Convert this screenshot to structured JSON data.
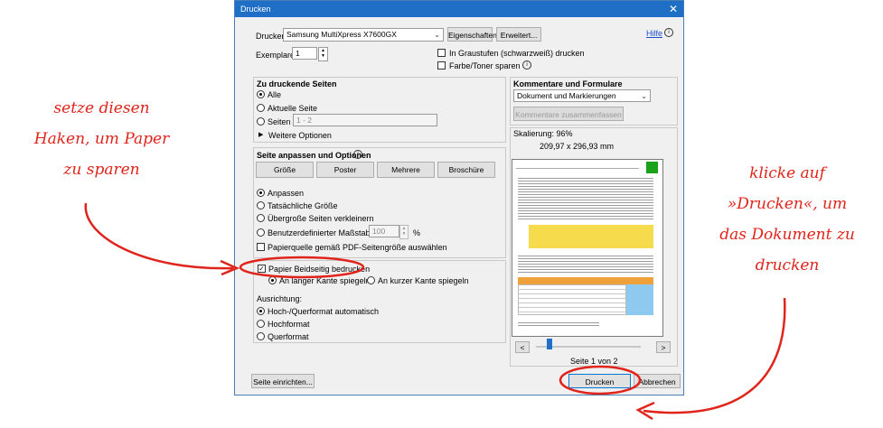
{
  "title": "Drucken",
  "close_glyph": "✕",
  "help_link": "Hilfe",
  "printer_label": "Drucker:",
  "printer_value": "Samsung MultiXpress X7600GX",
  "properties_button": "Eigenschaften",
  "advanced_button": "Erweitert...",
  "copies_label": "Exemplare:",
  "copies_value": "1",
  "grayscale_label": "In Graustufen (schwarzweiß) drucken",
  "save_toner_label": "Farbe/Toner sparen",
  "pages_section": {
    "title": "Zu druckende Seiten",
    "all": "Alle",
    "current": "Aktuelle Seite",
    "pages": "Seiten",
    "pages_value": "1 - 2",
    "more_options": "Weitere Optionen"
  },
  "sizing_section": {
    "title": "Seite anpassen und Optionen",
    "buttons": [
      "Größe",
      "Poster",
      "Mehrere",
      "Broschüre"
    ],
    "fit": "Anpassen",
    "actual": "Tatsächliche Größe",
    "shrink": "Übergroße Seiten verkleinern",
    "custom": "Benutzerdefinierter Maßstab:",
    "custom_value": "100",
    "percent": "%",
    "paper_source": "Papierquelle gemäß PDF-Seitengröße auswählen",
    "duplex": "Papier Beidseitig bedrucken",
    "long_edge": "An langer Kante spiegeln",
    "short_edge": "An kurzer Kante spiegeln",
    "orientation_label": "Ausrichtung:",
    "orient_auto": "Hoch-/Querformat automatisch",
    "orient_portrait": "Hochformat",
    "orient_landscape": "Querformat"
  },
  "comments_section": {
    "title": "Kommentare und Formulare",
    "select_value": "Dokument und Markierungen",
    "summarize_button": "Kommentare zusammenfassen"
  },
  "scaling_text": "Skalierung: 96%",
  "paper_size": "209,97 x 296,93 mm",
  "prev_button": "<",
  "next_button": ">",
  "page_indicator": "Seite 1 von 2",
  "page_setup_button": "Seite einrichten...",
  "print_button": "Drucken",
  "cancel_button": "Abbrechen",
  "annotation_left": [
    "setze diesen",
    "Haken, um Paper",
    "zu sparen"
  ],
  "annotation_right": [
    "klicke auf",
    "»Drucken«, um",
    "das Dokument zu",
    "drucken"
  ],
  "colors": {
    "title_bar": "#1f6fc6",
    "annotation": "#e0241b",
    "dialog_bg": "#f0f0f0"
  }
}
